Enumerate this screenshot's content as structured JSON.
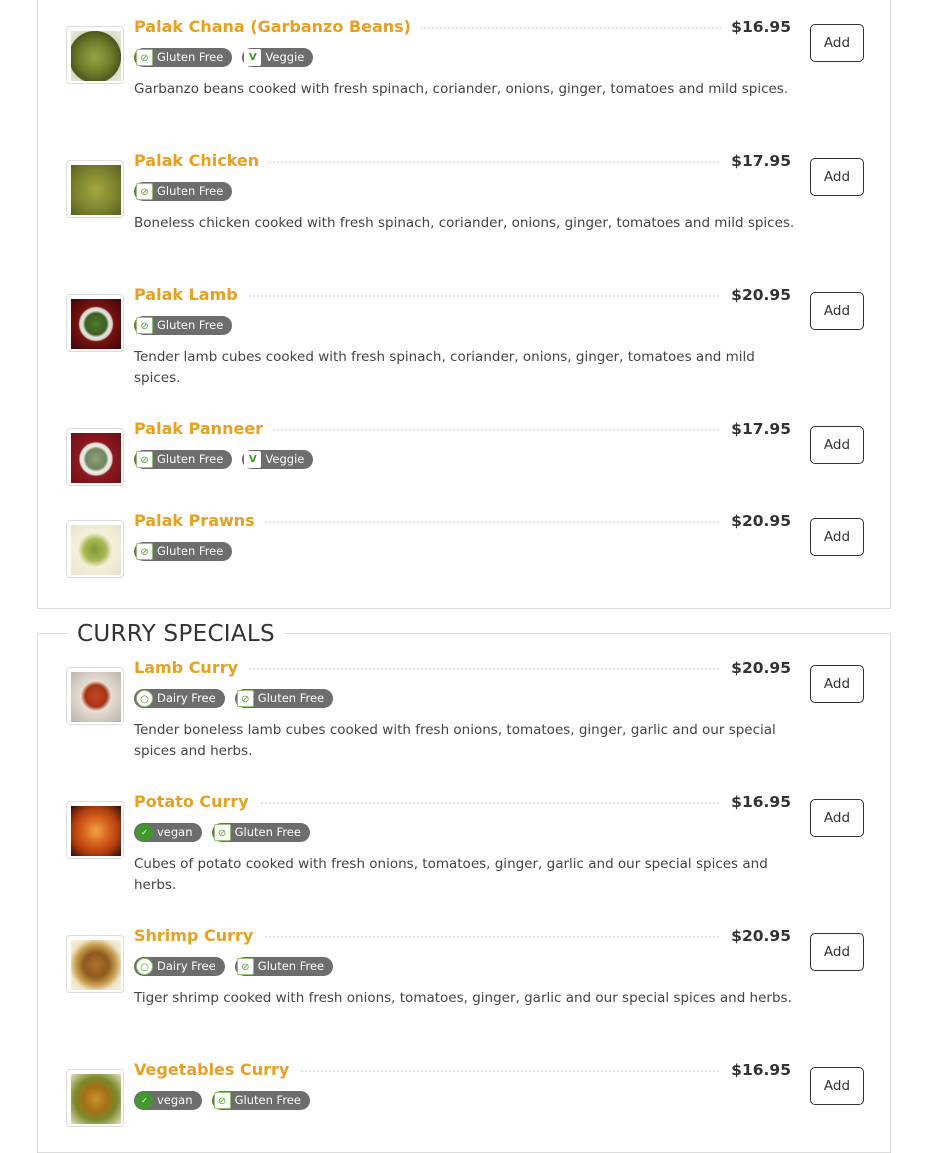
{
  "sections": [
    {
      "title": "",
      "items": [
        {
          "name": "Palak Chana (Garbanzo Beans)",
          "price": "$16.95",
          "add_label": "Add",
          "tags": [
            {
              "icon": "gluten-free-icon",
              "label": "Gluten Free"
            },
            {
              "icon": "veggie-icon",
              "label": "Veggie"
            }
          ],
          "description": "Garbanzo beans cooked with fresh spinach, coriander, onions, ginger, tomatoes and mild spices."
        },
        {
          "name": "Palak Chicken",
          "price": "$17.95",
          "add_label": "Add",
          "tags": [
            {
              "icon": "gluten-free-icon",
              "label": "Gluten Free"
            }
          ],
          "description": "Boneless chicken cooked with fresh spinach, coriander, onions, ginger, tomatoes and mild spices."
        },
        {
          "name": "Palak Lamb",
          "price": "$20.95",
          "add_label": "Add",
          "tags": [
            {
              "icon": "gluten-free-icon",
              "label": "Gluten Free"
            }
          ],
          "description": "Tender lamb cubes cooked with fresh spinach, coriander, onions, ginger, tomatoes and mild spices."
        },
        {
          "name": "Palak Panneer",
          "price": "$17.95",
          "add_label": "Add",
          "tags": [
            {
              "icon": "gluten-free-icon",
              "label": "Gluten Free"
            },
            {
              "icon": "veggie-icon",
              "label": "Veggie"
            }
          ],
          "description": ""
        },
        {
          "name": "Palak Prawns",
          "price": "$20.95",
          "add_label": "Add",
          "tags": [
            {
              "icon": "gluten-free-icon",
              "label": "Gluten Free"
            }
          ],
          "description": ""
        }
      ]
    },
    {
      "title": "CURRY SPECIALS",
      "items": [
        {
          "name": "Lamb Curry",
          "price": "$20.95",
          "add_label": "Add",
          "tags": [
            {
              "icon": "dairy-free-icon",
              "label": "Dairy Free"
            },
            {
              "icon": "gluten-free-icon",
              "label": "Gluten Free"
            }
          ],
          "description": "Tender boneless lamb cubes cooked with fresh onions, tomatoes, ginger, garlic and our special spices and herbs."
        },
        {
          "name": "Potato Curry",
          "price": "$16.95",
          "add_label": "Add",
          "tags": [
            {
              "icon": "vegan-icon",
              "label": "vegan"
            },
            {
              "icon": "gluten-free-icon",
              "label": "Gluten Free"
            }
          ],
          "description": "Cubes of potato cooked with fresh onions, tomatoes, ginger, garlic and our special spices and herbs."
        },
        {
          "name": "Shrimp Curry",
          "price": "$20.95",
          "add_label": "Add",
          "tags": [
            {
              "icon": "dairy-free-icon",
              "label": "Dairy Free"
            },
            {
              "icon": "gluten-free-icon",
              "label": "Gluten Free"
            }
          ],
          "description": "Tiger shrimp cooked with fresh onions, tomatoes, ginger, garlic and our special spices and herbs."
        },
        {
          "name": "Vegetables Curry",
          "price": "$16.95",
          "add_label": "Add",
          "tags": [
            {
              "icon": "vegan-icon",
              "label": "vegan"
            },
            {
              "icon": "gluten-free-icon",
              "label": "Gluten Free"
            }
          ],
          "description": ""
        }
      ]
    }
  ],
  "colors": {
    "item_name": "#e8a020",
    "tag_bg": "#6d6d6d",
    "leader": "#e2e2e2"
  }
}
